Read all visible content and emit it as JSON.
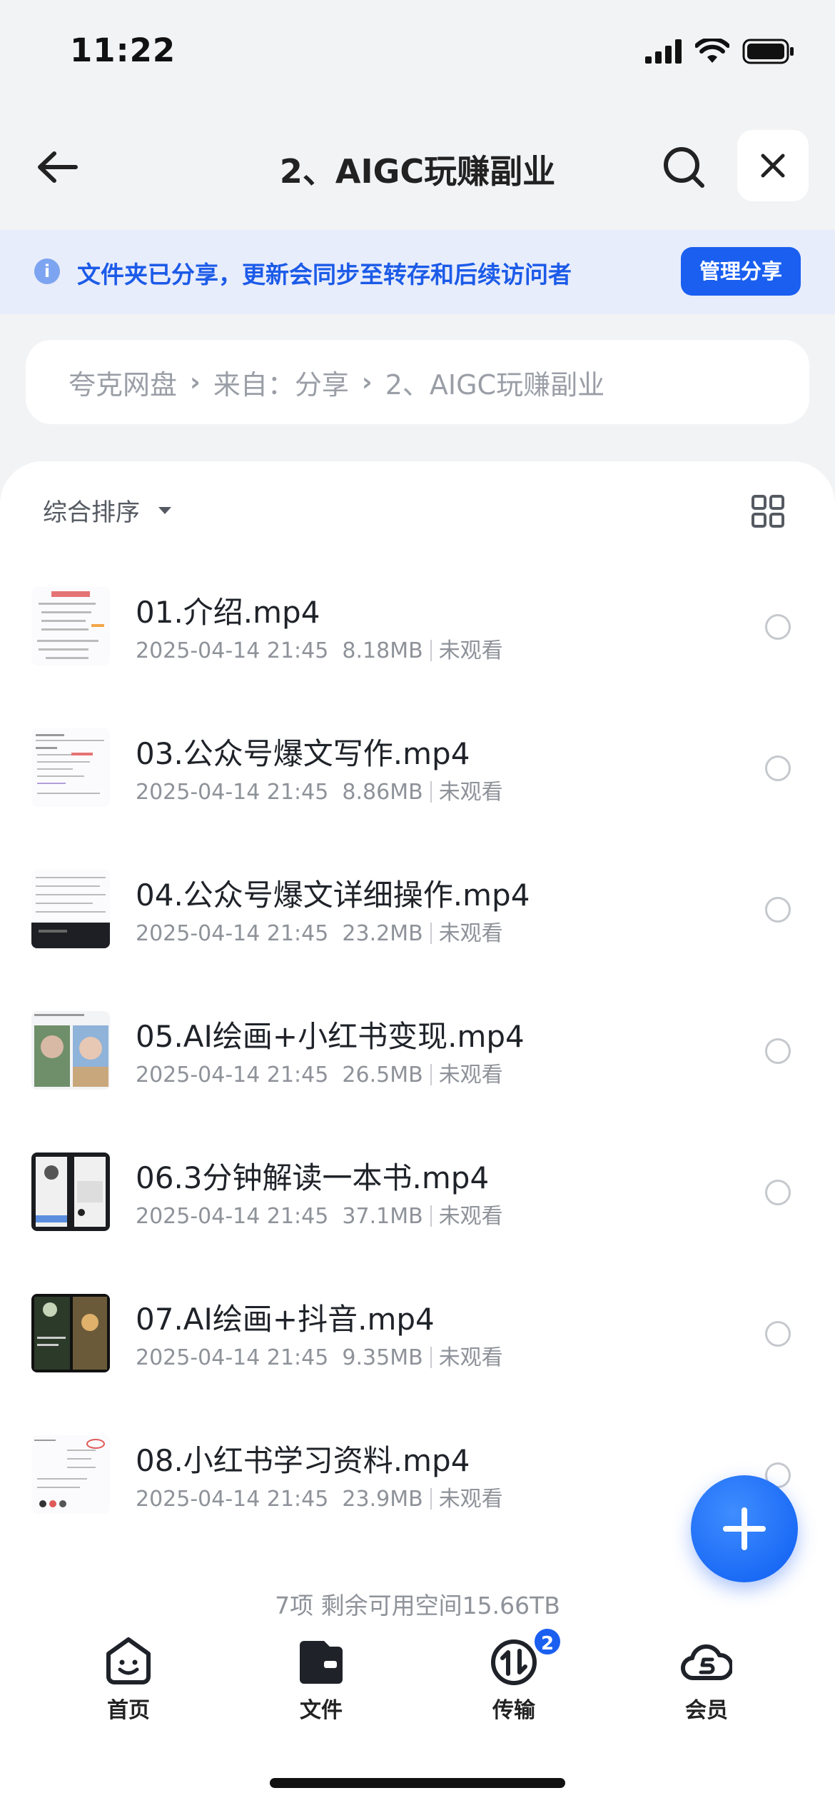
{
  "status_bar": {
    "time": "11:22"
  },
  "header": {
    "title": "2、AIGC玩赚副业"
  },
  "share_banner": {
    "text": "文件夹已分享，更新会同步至转存和后续访问者",
    "button_label": "管理分享",
    "info_glyph": "i"
  },
  "breadcrumb": {
    "items": [
      "夸克网盘",
      "来自：分享",
      "2、AIGC玩赚副业"
    ],
    "separator": "›"
  },
  "sort": {
    "label": "综合排序"
  },
  "files": [
    {
      "name": "01.介绍.mp4",
      "date": "2025-04-14 21:45",
      "size": "8.18MB",
      "status": "未观看"
    },
    {
      "name": "03.公众号爆文写作.mp4",
      "date": "2025-04-14 21:45",
      "size": "8.86MB",
      "status": "未观看"
    },
    {
      "name": "04.公众号爆文详细操作.mp4",
      "date": "2025-04-14 21:45",
      "size": "23.2MB",
      "status": "未观看"
    },
    {
      "name": "05.AI绘画+小红书变现.mp4",
      "date": "2025-04-14 21:45",
      "size": "26.5MB",
      "status": "未观看"
    },
    {
      "name": "06.3分钟解读一本书.mp4",
      "date": "2025-04-14 21:45",
      "size": "37.1MB",
      "status": "未观看"
    },
    {
      "name": "07.AI绘画+抖音.mp4",
      "date": "2025-04-14 21:45",
      "size": "9.35MB",
      "status": "未观看"
    },
    {
      "name": "08.小红书学习资料.mp4",
      "date": "2025-04-14 21:45",
      "size": "23.9MB",
      "status": "未观看"
    }
  ],
  "summary": "7项 剩余可用空间15.66TB",
  "tabbar": {
    "tabs": [
      {
        "label": "首页",
        "icon": "home-face-icon"
      },
      {
        "label": "文件",
        "icon": "folder-icon"
      },
      {
        "label": "传输",
        "icon": "transfer-icon",
        "badge": "2"
      },
      {
        "label": "会员",
        "icon": "vip-cloud-icon"
      }
    ]
  },
  "colors": {
    "accent": "#1a5ff0",
    "banner_bg": "#e8edfb",
    "page_bg": "#f2f3f5"
  }
}
